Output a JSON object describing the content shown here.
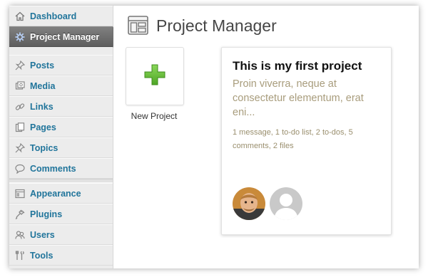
{
  "sidebar": {
    "items": [
      {
        "label": "Dashboard",
        "icon": "home-icon"
      },
      {
        "label": "Project Manager",
        "icon": "gear-icon",
        "active": true
      },
      {
        "label": "Posts",
        "icon": "pushpin-icon"
      },
      {
        "label": "Media",
        "icon": "media-icon"
      },
      {
        "label": "Links",
        "icon": "link-icon"
      },
      {
        "label": "Pages",
        "icon": "pages-icon"
      },
      {
        "label": "Topics",
        "icon": "pushpin-icon"
      },
      {
        "label": "Comments",
        "icon": "comment-icon"
      },
      {
        "label": "Appearance",
        "icon": "appearance-icon"
      },
      {
        "label": "Plugins",
        "icon": "plug-icon"
      },
      {
        "label": "Users",
        "icon": "users-icon"
      },
      {
        "label": "Tools",
        "icon": "tools-icon"
      }
    ]
  },
  "main": {
    "title": "Project Manager",
    "new_project": {
      "label": "New Project",
      "icon": "plus-icon"
    },
    "project": {
      "title": "This is my first project",
      "description": "Proin viverra, neque at consectetur elementum, erat eni...",
      "meta": "1 message, 1 to-do list, 2 to-dos, 5 comments, 2 files",
      "members": [
        "avatar-photo",
        "avatar-default"
      ]
    }
  },
  "colors": {
    "link_blue": "#21759b",
    "active_bg": "#6e6e6e",
    "plus_green": "#6cc23a",
    "muted_text": "#a89c7c"
  }
}
